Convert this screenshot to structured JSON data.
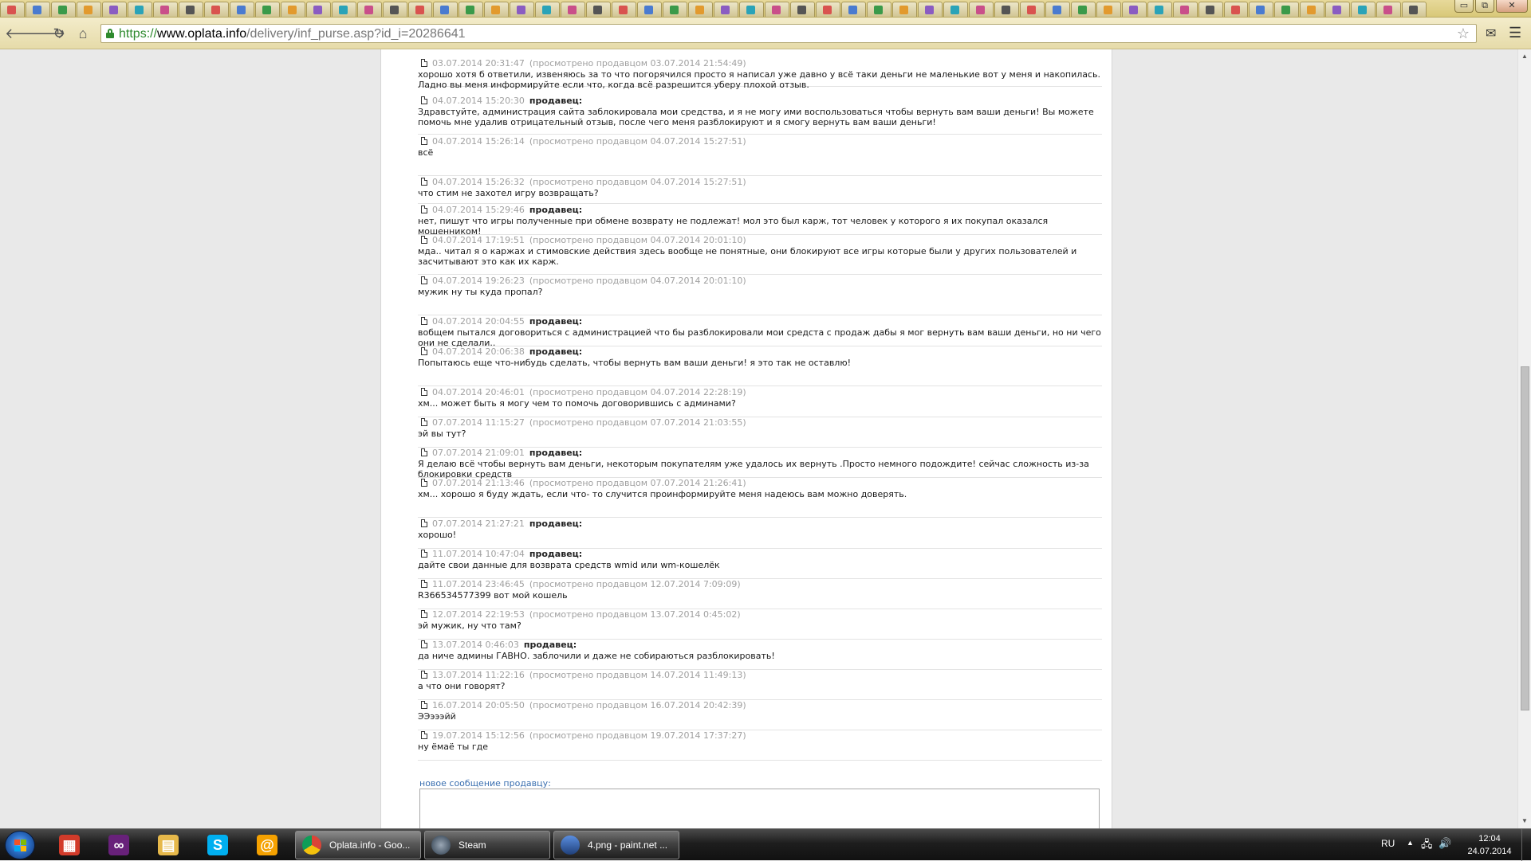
{
  "browser": {
    "url_scheme": "https://",
    "url_host": "www.oplata.info",
    "url_path": "/delivery/inf_purse.asp?id_i=20286641",
    "icons": [
      "back-icon",
      "forward-icon",
      "reload-icon",
      "home-icon",
      "lock-icon",
      "star-icon",
      "mail-extension-icon",
      "menu-icon"
    ],
    "tab_count": 56,
    "window_buttons": {
      "minimize": "▭",
      "restore": "⧉",
      "close": "✕"
    }
  },
  "messages": [
    {
      "date": "03.07.2014 20:31:47",
      "viewed": "(просмотрено продавцом 03.07.2014 21:54:49)",
      "author": "",
      "text": "хорошо хотя б ответили, извеняюсь за то что погорячился просто я написал уже давно у всё таки деньги не маленькие вот у меня и накопилась. Ладно вы меня информируйте если что, когда всё разрешится уберу плохой отзыв."
    },
    {
      "date": "04.07.2014 15:20:30",
      "viewed": "",
      "author": "продавец:",
      "text": "Здравстуйте, администрация сайта заблокировала мои средства, и я не могу ими воспользоваться чтобы вернуть вам ваши деньги! Вы можете помочь мне удалив отрицательный отзыв, после чего меня разблокируют и я смогу вернуть вам ваши деньги!"
    },
    {
      "date": "04.07.2014 15:26:14",
      "viewed": "(просмотрено продавцом 04.07.2014 15:27:51)",
      "author": "",
      "text": "всё"
    },
    {
      "date": "04.07.2014 15:26:32",
      "viewed": "(просмотрено продавцом 04.07.2014 15:27:51)",
      "author": "",
      "text": "что стим не захотел игру возвращать?"
    },
    {
      "date": "04.07.2014 15:29:46",
      "viewed": "",
      "author": "продавец:",
      "text": "нет, пишут что игры полученные при обмене возврату не подлежат! мол это был карж, тот человек у которого я их покупал оказался мошенником!"
    },
    {
      "date": "04.07.2014 17:19:51",
      "viewed": "(просмотрено продавцом 04.07.2014 20:01:10)",
      "author": "",
      "text": "мда.. читал я о каржах и стимовские действия здесь вообще не понятные, они блокируют все игры которые были у других пользователей и засчитывают это как их карж."
    },
    {
      "date": "04.07.2014 19:26:23",
      "viewed": "(просмотрено продавцом 04.07.2014 20:01:10)",
      "author": "",
      "text": "мужик ну ты куда пропал?"
    },
    {
      "date": "04.07.2014 20:04:55",
      "viewed": "",
      "author": "продавец:",
      "text": "вобщем пытался договориться с администрацией что бы разблокировали мои средста с продаж дабы я мог вернуть вам ваши деньги, но ни чего они не сделали.."
    },
    {
      "date": "04.07.2014 20:06:38",
      "viewed": "",
      "author": "продавец:",
      "text": "Попытаюсь еще что-нибудь сделать, чтобы вернуть вам ваши деньги! я это так не оставлю!"
    },
    {
      "date": "04.07.2014 20:46:01",
      "viewed": "(просмотрено продавцом 04.07.2014 22:28:19)",
      "author": "",
      "text": "хм... может быть я могу чем то помочь договорившись с админами?"
    },
    {
      "date": "07.07.2014 11:15:27",
      "viewed": "(просмотрено продавцом 07.07.2014 21:03:55)",
      "author": "",
      "text": "эй вы тут?"
    },
    {
      "date": "07.07.2014 21:09:01",
      "viewed": "",
      "author": "продавец:",
      "text": "Я делаю всё чтобы вернуть вам деньги, некоторым покупателям уже удалось их вернуть .Просто немного подождите! сейчас сложность из-за блокировки средств"
    },
    {
      "date": "07.07.2014 21:13:46",
      "viewed": "(просмотрено продавцом 07.07.2014 21:26:41)",
      "author": "",
      "text": "хм... хорошо я буду ждать, если что- то случится проинформируйте меня надеюсь вам можно доверять."
    },
    {
      "date": "07.07.2014 21:27:21",
      "viewed": "",
      "author": "продавец:",
      "text": "хорошо!"
    },
    {
      "date": "11.07.2014 10:47:04",
      "viewed": "",
      "author": "продавец:",
      "text": "дайте свои данные для возврата средств wmid или wm-кошелёк"
    },
    {
      "date": "11.07.2014 23:46:45",
      "viewed": "(просмотрено продавцом 12.07.2014 7:09:09)",
      "author": "",
      "text": "R366534577399 вот мой кошель"
    },
    {
      "date": "12.07.2014 22:19:53",
      "viewed": "(просмотрено продавцом 13.07.2014 0:45:02)",
      "author": "",
      "text": "эй мужик, ну что там?"
    },
    {
      "date": "13.07.2014 0:46:03",
      "viewed": "",
      "author": "продавец:",
      "text": "да ниче админы ГАВНО. заблочили и даже не собираються разблокировать!"
    },
    {
      "date": "13.07.2014 11:22:16",
      "viewed": "(просмотрено продавцом 14.07.2014 11:49:13)",
      "author": "",
      "text": "а что они говорят?"
    },
    {
      "date": "16.07.2014 20:05:50",
      "viewed": "(просмотрено продавцом 16.07.2014 20:42:39)",
      "author": "",
      "text": "ЭЭэээйй"
    },
    {
      "date": "19.07.2014 15:12:56",
      "viewed": "(просмотрено продавцом 19.07.2014 17:37:27)",
      "author": "",
      "text": "ну ёмаё ты где"
    }
  ],
  "new_message_label": "новое сообщение продавцу:",
  "taskbar": {
    "pins": [
      {
        "icon": "apps-grid-icon",
        "color": "#d23b2a"
      },
      {
        "icon": "visual-studio-icon",
        "color": "#68217a"
      },
      {
        "icon": "file-explorer-icon",
        "color": "#e6b84a"
      },
      {
        "icon": "skype-icon",
        "color": "#00aff0"
      },
      {
        "icon": "mail-agent-icon",
        "color": "#f5a100"
      }
    ],
    "tasks": [
      {
        "label": "Oplata.info - Goo...",
        "icon": "chrome-icon",
        "active": true
      },
      {
        "label": "Steam",
        "icon": "steam-icon",
        "active": false
      },
      {
        "label": "4.png - paint.net ...",
        "icon": "paintnet-icon",
        "active": false
      }
    ],
    "language": "RU",
    "time": "12:04",
    "date": "24.07.2014"
  }
}
